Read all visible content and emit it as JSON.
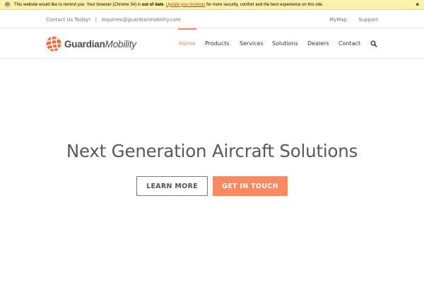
{
  "notice": {
    "text_before": "This website would like to remind you: Your browser (Chrome 34) is ",
    "text_bold": "out of date",
    "text_mid": ". ",
    "link_label": "Update your browser",
    "text_after": " for more security, comfort and the best experience on this site.",
    "close_label": "×",
    "icon": "chrome-icon"
  },
  "topbar": {
    "contact_label": "Contact Us Today!",
    "separator": "|",
    "email": "inquiries@guardianmobility.com",
    "links": [
      "MyMap",
      "Support"
    ]
  },
  "header": {
    "logo_bold": "Guardian",
    "logo_italic": "Mobility",
    "nav": [
      "Home",
      "Products",
      "Services",
      "Solutions",
      "Dealers",
      "Contact"
    ],
    "active_nav": "Home",
    "search_icon": "search-icon"
  },
  "hero": {
    "title": "Next Generation Aircraft Solutions",
    "primary_button": "LEARN MORE",
    "secondary_button": "GET IN TOUCH"
  },
  "colors": {
    "accent": "#f7845e",
    "button_orange": "#fa8862",
    "notice_bg": "#fdf2ab",
    "text": "#595959"
  }
}
